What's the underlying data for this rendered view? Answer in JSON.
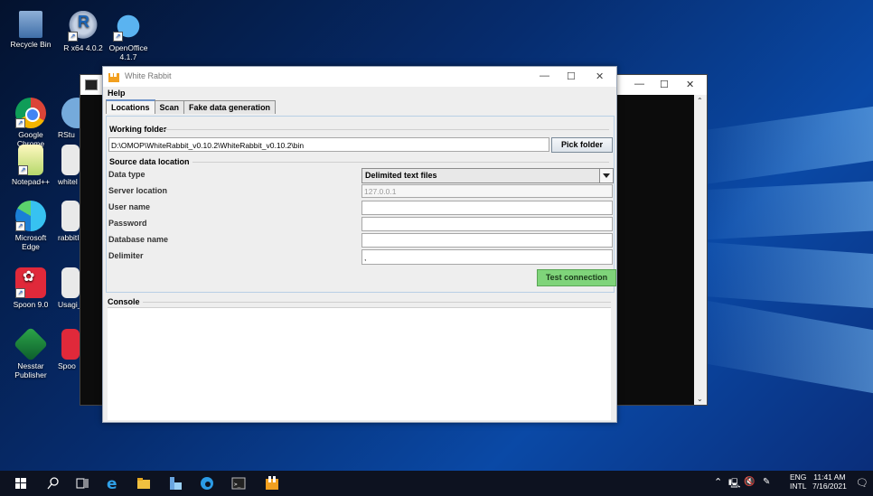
{
  "desktop": {
    "icons": [
      {
        "label": "Recycle Bin",
        "icon": "recycle-bin-icon"
      },
      {
        "label": "R x64 4.0.2",
        "icon": "r-icon"
      },
      {
        "label": "OpenOffice 4.1.7",
        "icon": "openoffice-icon"
      },
      {
        "label": "Google Chrome",
        "icon": "chrome-icon"
      },
      {
        "label": "RStu",
        "icon": "rstudio-icon"
      },
      {
        "label": "Notepad++",
        "icon": "notepadpp-icon"
      },
      {
        "label": "whitel",
        "icon": "whiterabbit-folder-icon"
      },
      {
        "label": "Microsoft Edge",
        "icon": "edge-icon"
      },
      {
        "label": "rabbitI",
        "icon": "rabbitinahat-folder-icon"
      },
      {
        "label": "Spoon 9.0",
        "icon": "spoon-icon"
      },
      {
        "label": "Usagi_",
        "icon": "usagi-icon"
      },
      {
        "label": "Nesstar Publisher",
        "icon": "nesstar-icon"
      },
      {
        "label": "Spoo",
        "icon": "spoon-shortcut-icon"
      }
    ]
  },
  "window": {
    "title": "White Rabbit",
    "menu": [
      "Help"
    ],
    "tabs": [
      "Locations",
      "Scan",
      "Fake data generation"
    ],
    "working_folder": {
      "label": "Working folder",
      "value": "D:\\OMOP\\WhiteRabbit_v0.10.2\\WhiteRabbit_v0.10.2\\bin",
      "button": "Pick folder"
    },
    "source": {
      "label": "Source data location",
      "data_type_label": "Data type",
      "data_type_value": "Delimited text files",
      "server_label": "Server location",
      "server_value": "127.0.0.1",
      "user_label": "User name",
      "user_value": "",
      "password_label": "Password",
      "password_value": "",
      "database_label": "Database name",
      "database_value": "",
      "delimiter_label": "Delimiter",
      "delimiter_value": ",",
      "test_button": "Test connection"
    },
    "console_label": "Console"
  },
  "taskbar": {
    "lang_top": "ENG",
    "lang_bottom": "INTL",
    "time": "11:41 AM",
    "date": "7/16/2021"
  }
}
